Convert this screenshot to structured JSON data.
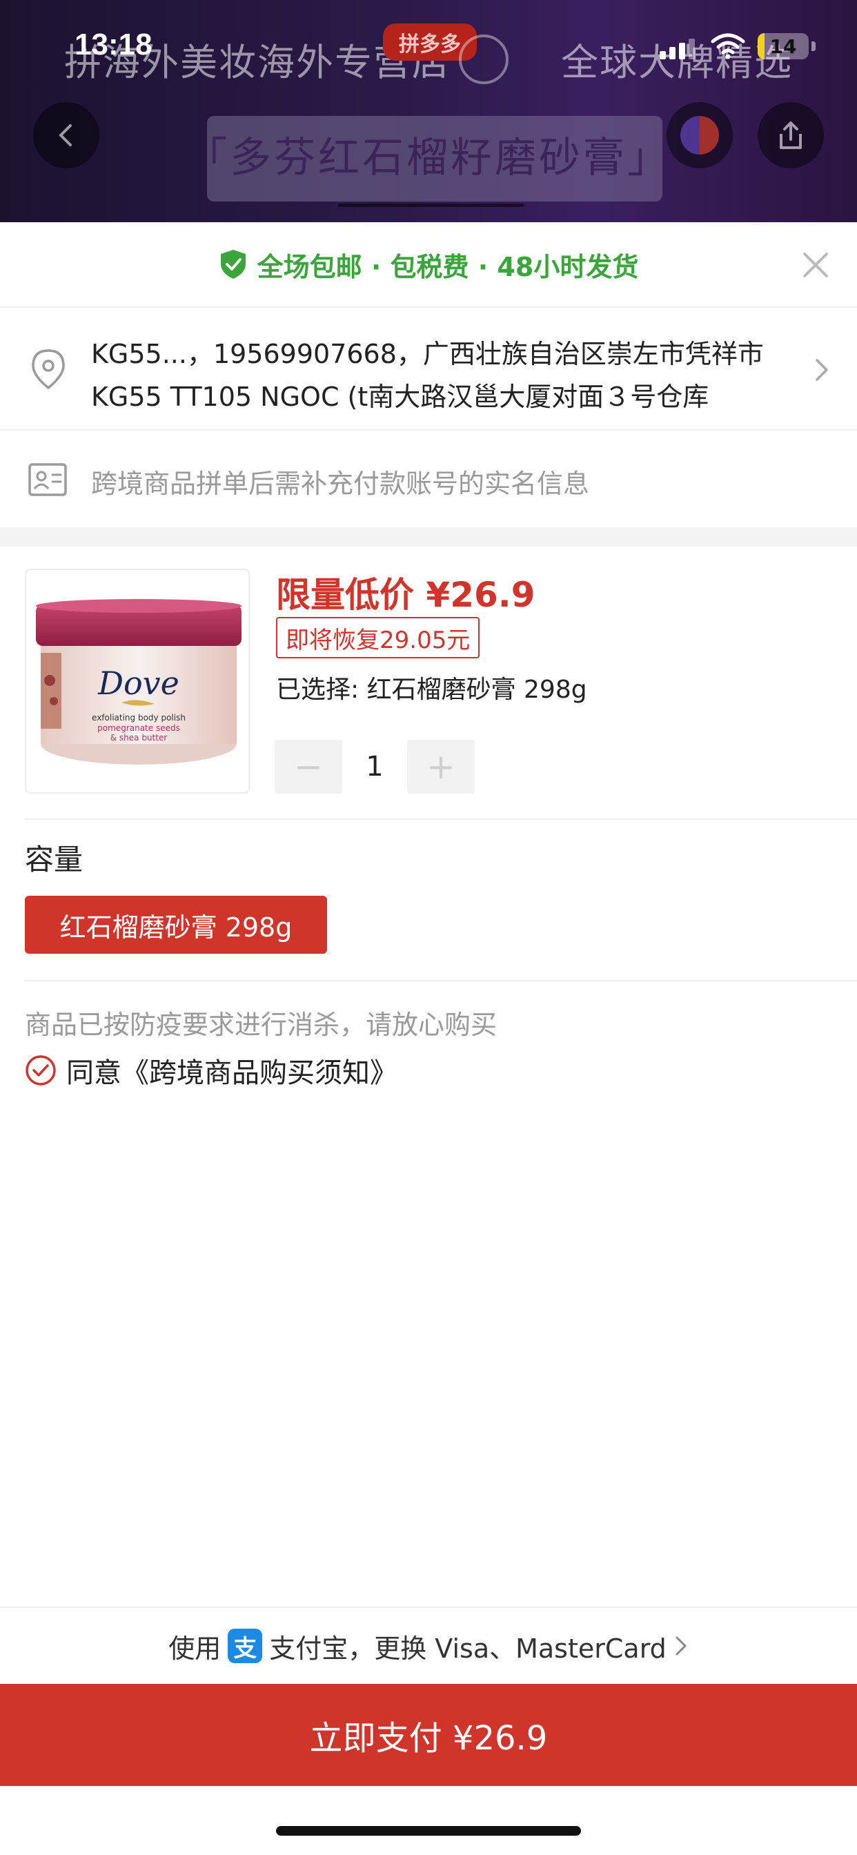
{
  "status_bar": {
    "time": "13:18",
    "battery": "14",
    "battery_level": 0.14
  },
  "background_page": {
    "banner_text": "拼海外美妆海外专营店",
    "banner_brand": "拼多多",
    "banner_right": "全球大牌精选",
    "title": "「多芬红石榴籽磨砂膏」"
  },
  "sheet": {
    "promo": "全场包邮 · 包税费 · 48小时发货",
    "address": {
      "line1": "KG55...，19569907668，广西壮族自治区崇左市凭祥市",
      "line2": "KG55 TT105 NGOC (t南大路汉邕大厦对面３号仓库"
    },
    "realname_notice": "跨境商品拼单后需补充付款账号的实名信息",
    "product": {
      "price_label": "限量低价 ¥26.9",
      "restore_badge": "即将恢复29.05元",
      "selected": "已选择: 红石榴磨砂膏 298g",
      "quantity": "1",
      "minus": "−",
      "plus": "+",
      "jar_brand": "Dove",
      "jar_line1": "exfoliating body polish",
      "jar_line2": "pomegranate seeds",
      "jar_line3": "& shea butter"
    },
    "spec": {
      "title": "容量",
      "option": "红石榴磨砂膏 298g"
    },
    "disinfect_note": "商品已按防疫要求进行消杀，请放心购买",
    "agree_text": "同意《跨境商品购买须知》",
    "payment": {
      "prefix": "使用",
      "alipay_glyph": "支",
      "method": "支付宝，更换 Visa、MasterCard",
      "pay_button": "立即支付 ¥26.9"
    }
  },
  "colors": {
    "accent_red": "#d0352c",
    "promo_green": "#3aa53a",
    "alipay_blue": "#1a8ae5"
  }
}
